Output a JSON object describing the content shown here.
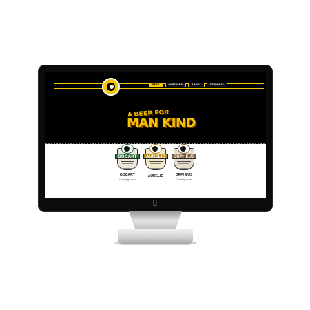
{
  "nav": {
    "items": [
      {
        "label": "Beer",
        "active": true
      },
      {
        "label": "Partners",
        "active": false
      },
      {
        "label": "About",
        "active": false
      },
      {
        "label": "Students",
        "active": false
      }
    ]
  },
  "hero": {
    "line1": "A BEER FOR",
    "line2": "MAN KIND"
  },
  "beers": [
    {
      "name": "BOGART",
      "badge_label": "BOGART",
      "status": "Coming soon",
      "color": "#2e6b3a",
      "rim": "#7fa66b"
    },
    {
      "name": "AURELIO",
      "badge_label": "AURELIO",
      "status": "",
      "color": "#b98a1c",
      "rim": "#e2c36a"
    },
    {
      "name": "ORPHEUS",
      "badge_label": "ORPHEUS",
      "status": "Coming soon",
      "color": "#7a5a3a",
      "rim": "#c9a27a"
    }
  ],
  "colors": {
    "accent": "#f5c400",
    "background": "#000000"
  },
  "icons": {
    "device_logo": "apple-logo-icon"
  }
}
